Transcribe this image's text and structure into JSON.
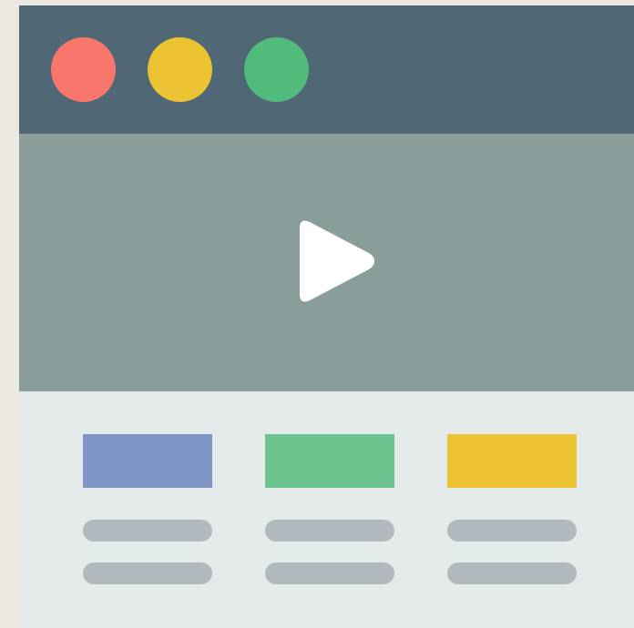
{
  "colors": {
    "page_background": "#EAE8DF",
    "titlebar": "#506775",
    "video_area": "#899E9B",
    "content_area": "#E4EAEA",
    "play_icon": "#FFFFFF",
    "text_placeholder": "#B1B8BE"
  },
  "window_controls": [
    {
      "name": "close",
      "color": "#F7786B"
    },
    {
      "name": "minimize",
      "color": "#EBC232"
    },
    {
      "name": "maximize",
      "color": "#51BB7B"
    }
  ],
  "video": {
    "icon": "play-icon"
  },
  "cards": [
    {
      "thumb_color": "#7F95C7",
      "placeholder_lines": 2
    },
    {
      "thumb_color": "#6BC48E",
      "placeholder_lines": 2
    },
    {
      "thumb_color": "#EBC232",
      "placeholder_lines": 2
    }
  ]
}
